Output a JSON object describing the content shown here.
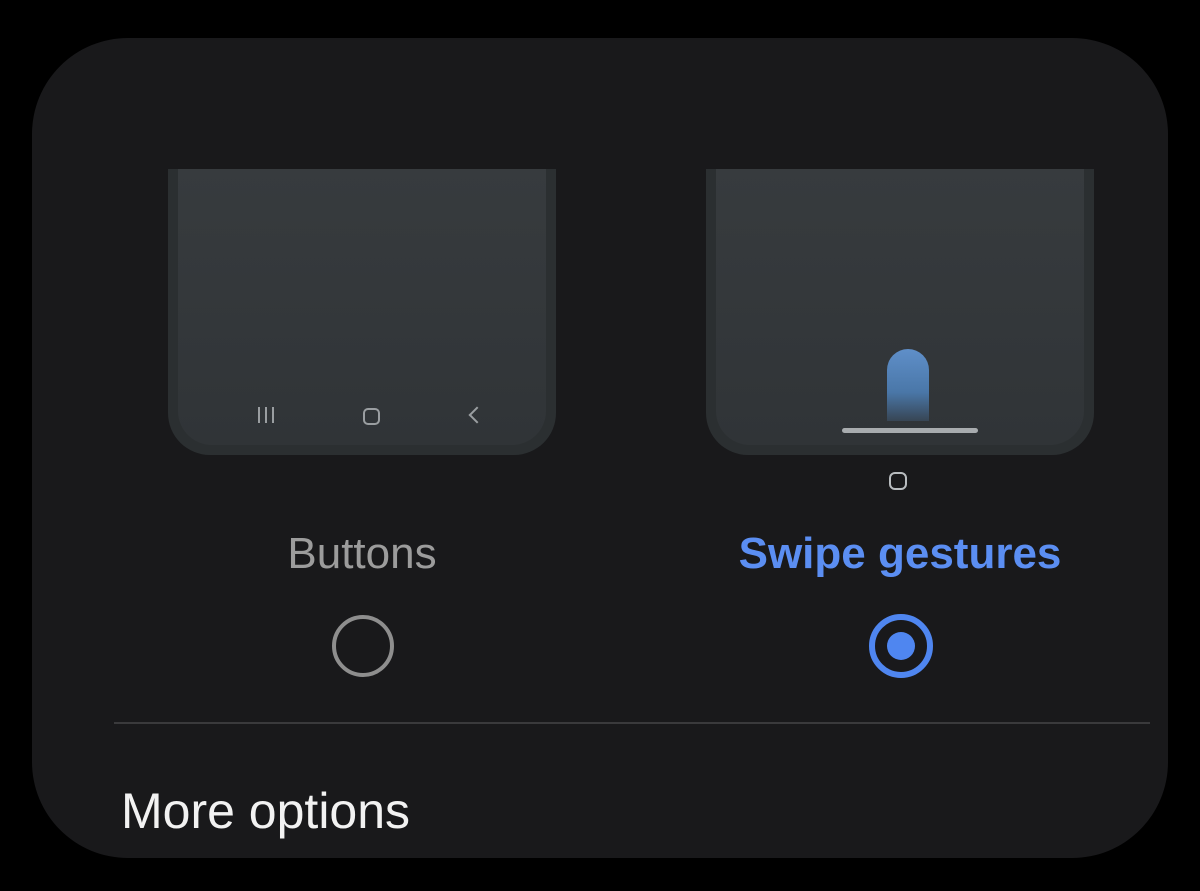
{
  "options": [
    {
      "label": "Buttons",
      "selected": false,
      "navbar_icons": [
        "recents-icon",
        "home-icon",
        "back-icon"
      ]
    },
    {
      "label": "Swipe gestures",
      "selected": true,
      "illustration_icons": [
        "swipe-finger-icon",
        "gesture-bar-icon",
        "home-icon"
      ]
    }
  ],
  "more_options": {
    "label": "More options"
  },
  "colors": {
    "background": "#000000",
    "card": "#19191b",
    "accent": "#4f86f0",
    "selected_text": "#5b8ef2",
    "unselected_text": "#9c9c9c",
    "primary_text": "#f2f2f2"
  }
}
